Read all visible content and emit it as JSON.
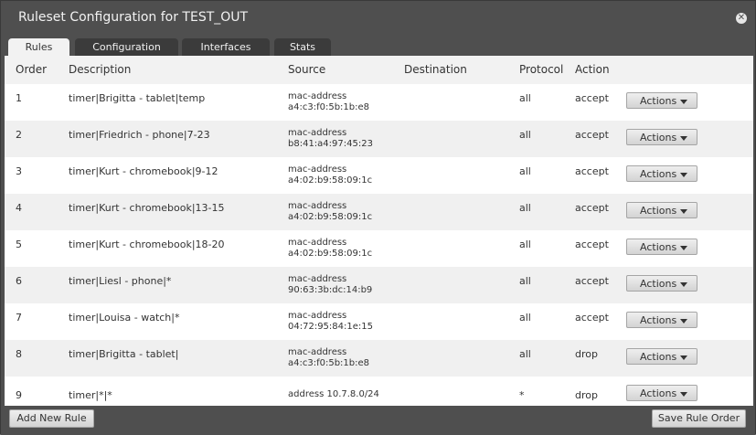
{
  "dialog": {
    "title": "Ruleset Configuration for TEST_OUT"
  },
  "tabs": [
    "Rules",
    "Configuration",
    "Interfaces",
    "Stats"
  ],
  "table": {
    "headers": {
      "order": "Order",
      "description": "Description",
      "source": "Source",
      "destination": "Destination",
      "protocol": "Protocol",
      "action": "Action"
    },
    "rows": [
      {
        "order": "1",
        "description": "timer|Brigitta - tablet|temp",
        "source_type": "mac-address",
        "source_value": "a4:c3:f0:5b:1b:e8",
        "destination": "",
        "protocol": "all",
        "action": "accept",
        "actions_label": "Actions"
      },
      {
        "order": "2",
        "description": "timer|Friedrich - phone|7-23",
        "source_type": "mac-address",
        "source_value": "b8:41:a4:97:45:23",
        "destination": "",
        "protocol": "all",
        "action": "accept",
        "actions_label": "Actions"
      },
      {
        "order": "3",
        "description": "timer|Kurt - chromebook|9-12",
        "source_type": "mac-address",
        "source_value": "a4:02:b9:58:09:1c",
        "destination": "",
        "protocol": "all",
        "action": "accept",
        "actions_label": "Actions"
      },
      {
        "order": "4",
        "description": "timer|Kurt - chromebook|13-15",
        "source_type": "mac-address",
        "source_value": "a4:02:b9:58:09:1c",
        "destination": "",
        "protocol": "all",
        "action": "accept",
        "actions_label": "Actions"
      },
      {
        "order": "5",
        "description": "timer|Kurt - chromebook|18-20",
        "source_type": "mac-address",
        "source_value": "a4:02:b9:58:09:1c",
        "destination": "",
        "protocol": "all",
        "action": "accept",
        "actions_label": "Actions"
      },
      {
        "order": "6",
        "description": "timer|Liesl - phone|*",
        "source_type": "mac-address",
        "source_value": "90:63:3b:dc:14:b9",
        "destination": "",
        "protocol": "all",
        "action": "accept",
        "actions_label": "Actions"
      },
      {
        "order": "7",
        "description": "timer|Louisa - watch|*",
        "source_type": "mac-address",
        "source_value": "04:72:95:84:1e:15",
        "destination": "",
        "protocol": "all",
        "action": "accept",
        "actions_label": "Actions"
      },
      {
        "order": "8",
        "description": "timer|Brigitta - tablet|",
        "source_type": "mac-address",
        "source_value": "a4:c3:f0:5b:1b:e8",
        "destination": "",
        "protocol": "all",
        "action": "drop",
        "actions_label": "Actions"
      },
      {
        "order": "9",
        "description": "timer|*|*",
        "source_type": "address 10.7.8.0/24",
        "source_value": "",
        "destination": "",
        "protocol": "*",
        "action": "drop",
        "actions_label": "Actions"
      }
    ]
  },
  "footer": {
    "add_rule_label": "Add New Rule",
    "save_order_label": "Save Rule Order"
  },
  "colors": {
    "chrome": "#4f4f4f",
    "tab_inactive": "#3b3b3b",
    "row_alt": "#f0f0f0"
  }
}
